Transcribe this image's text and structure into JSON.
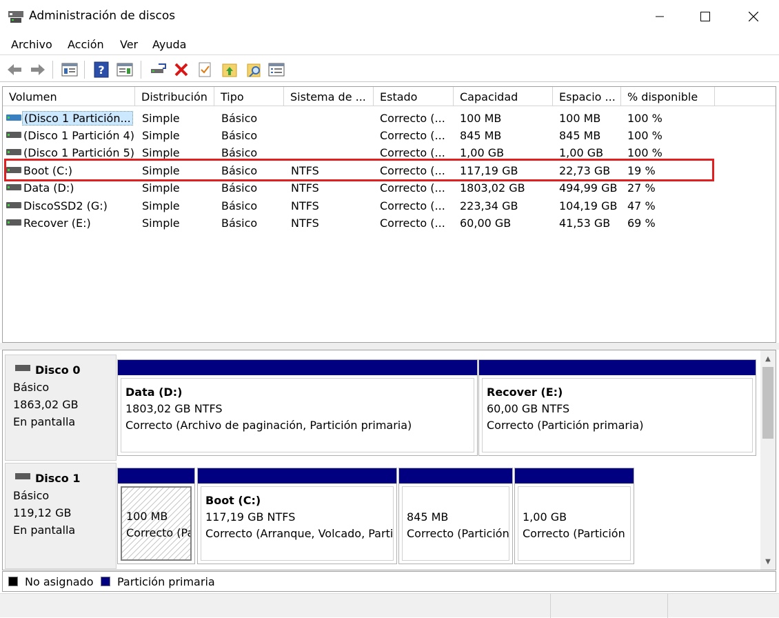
{
  "window": {
    "title": "Administración de discos"
  },
  "menu": [
    "Archivo",
    "Acción",
    "Ver",
    "Ayuda"
  ],
  "toolbar": {
    "icons": [
      "back-icon",
      "forward-icon",
      "show-hide-console-tree-icon",
      "help-icon",
      "show-hide-action-pane-icon",
      "connect-drive-icon",
      "delete-icon",
      "properties-check-icon",
      "upload-folder-icon",
      "search-folder-icon",
      "settings-list-icon"
    ]
  },
  "columns": [
    "Volumen",
    "Distribución",
    "Tipo",
    "Sistema de ...",
    "Estado",
    "Capacidad",
    "Espacio ...",
    "% disponible"
  ],
  "volumes": [
    {
      "name": "(Disco 1 Partición...",
      "layout": "Simple",
      "type": "Básico",
      "fs": "",
      "status": "Correcto (...",
      "capacity": "100 MB",
      "free": "100 MB",
      "pct": "100 %"
    },
    {
      "name": "(Disco 1 Partición 4)",
      "layout": "Simple",
      "type": "Básico",
      "fs": "",
      "status": "Correcto (...",
      "capacity": "845 MB",
      "free": "845 MB",
      "pct": "100 %"
    },
    {
      "name": "(Disco 1 Partición 5)",
      "layout": "Simple",
      "type": "Básico",
      "fs": "",
      "status": "Correcto (...",
      "capacity": "1,00 GB",
      "free": "1,00 GB",
      "pct": "100 %"
    },
    {
      "name": "Boot (C:)",
      "layout": "Simple",
      "type": "Básico",
      "fs": "NTFS",
      "status": "Correcto (...",
      "capacity": "117,19 GB",
      "free": "22,73 GB",
      "pct": "19 %"
    },
    {
      "name": "Data (D:)",
      "layout": "Simple",
      "type": "Básico",
      "fs": "NTFS",
      "status": "Correcto (...",
      "capacity": "1803,02 GB",
      "free": "494,99 GB",
      "pct": "27 %"
    },
    {
      "name": "DiscoSSD2 (G:)",
      "layout": "Simple",
      "type": "Básico",
      "fs": "NTFS",
      "status": "Correcto (...",
      "capacity": "223,34 GB",
      "free": "104,19 GB",
      "pct": "47 %"
    },
    {
      "name": "Recover (E:)",
      "layout": "Simple",
      "type": "Básico",
      "fs": "NTFS",
      "status": "Correcto (...",
      "capacity": "60,00 GB",
      "free": "41,53 GB",
      "pct": "69 %"
    }
  ],
  "disks": [
    {
      "name": "Disco 0",
      "type": "Básico",
      "size": "1863,02 GB",
      "state": "En pantalla",
      "partitions": [
        {
          "name": "Data  (D:)",
          "size": "1803,02 GB NTFS",
          "status": "Correcto (Archivo de paginación, Partición primaria)"
        },
        {
          "name": "Recover  (E:)",
          "size": "60,00 GB NTFS",
          "status": "Correcto (Partición primaria)"
        }
      ]
    },
    {
      "name": "Disco 1",
      "type": "Básico",
      "size": "119,12 GB",
      "state": "En pantalla",
      "partitions": [
        {
          "name": "",
          "size": "100 MB",
          "status": "Correcto (Pa"
        },
        {
          "name": "Boot  (C:)",
          "size": "117,19 GB NTFS",
          "status": "Correcto (Arranque, Volcado, Parti"
        },
        {
          "name": "",
          "size": "845 MB",
          "status": "Correcto (Partición"
        },
        {
          "name": "",
          "size": "1,00 GB",
          "status": "Correcto (Partición"
        }
      ]
    }
  ],
  "legend": [
    {
      "label": "No asignado",
      "color": "#000000"
    },
    {
      "label": "Partición primaria",
      "color": "#000080"
    }
  ],
  "colors": {
    "primary_partition": "#000080",
    "highlight": "#e02020",
    "selection": "#cce8ff"
  }
}
